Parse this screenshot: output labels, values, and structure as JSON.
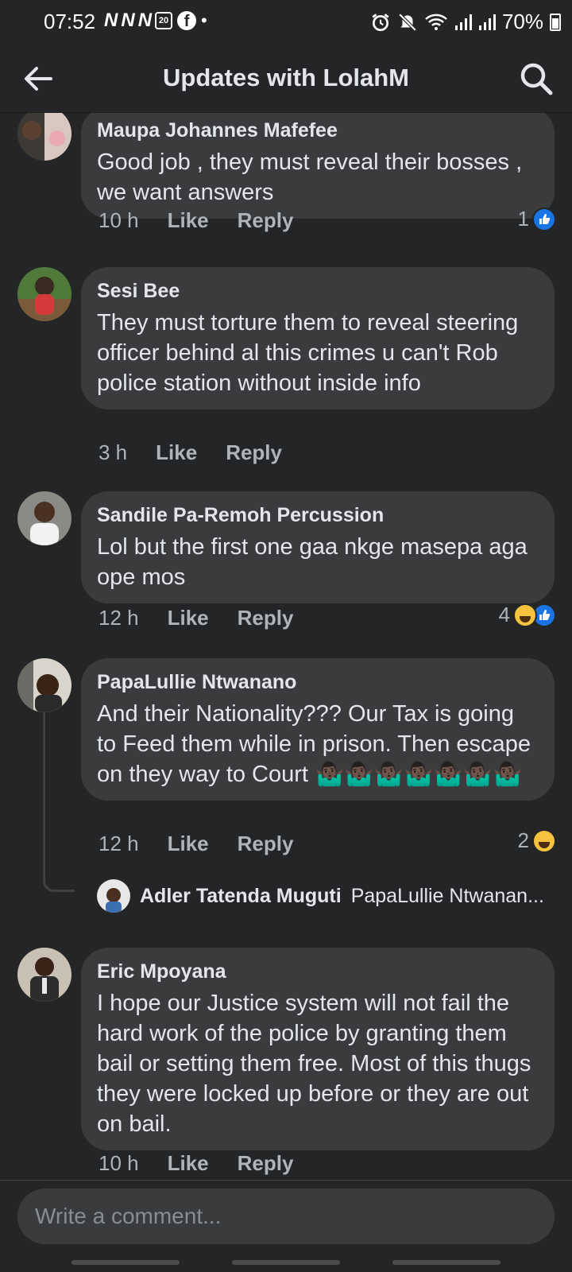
{
  "status_bar": {
    "time": "07:52",
    "notif_icons": [
      "N",
      "N",
      "N"
    ],
    "calendar_day": "20",
    "battery": "70%",
    "icons": [
      "alarm-icon",
      "mute-icon",
      "wifi-icon",
      "signal-icon",
      "signal-icon",
      "battery-icon"
    ]
  },
  "header": {
    "title": "Updates with LolahM"
  },
  "comments": [
    {
      "author": "Maupa Johannes Mafefee",
      "text": "Good job , they must reveal their bosses , we want answers",
      "ago": "10 h",
      "like_label": "Like",
      "reply_label": "Reply",
      "reaction_count": "1",
      "reactions": [
        "like"
      ]
    },
    {
      "author": "Sesi Bee",
      "text": "They must torture them to reveal steering officer behind al this crimes u can't Rob police station without inside info",
      "ago": "3 h",
      "like_label": "Like",
      "reply_label": "Reply"
    },
    {
      "author": "Sandile Pa-Remoh Percussion",
      "text": "Lol but the first one gaa nkge masepa aga ope mos",
      "ago": "12 h",
      "like_label": "Like",
      "reply_label": "Reply",
      "reaction_count": "4",
      "reactions": [
        "haha",
        "like"
      ]
    },
    {
      "author": "PapaLullie Ntwanano",
      "text": "And their Nationality??? Our Tax is going to Feed them while in prison. Then escape on they way to Court",
      "emojis": "🤷🏿‍♂️🤷🏿‍♂️🤷🏿‍♂️🤷🏿‍♂️🤷🏿‍♂️🤷🏿‍♂️🤷🏿‍♂️",
      "ago": "12 h",
      "like_label": "Like",
      "reply_label": "Reply",
      "reaction_count": "2",
      "reactions": [
        "haha"
      ],
      "reply_preview": {
        "author": "Adler Tatenda Muguti",
        "text": "PapaLullie Ntwanan..."
      }
    },
    {
      "author": "Eric Mpoyana",
      "text": "I hope our Justice system will not fail the hard work of the police by granting them bail or setting them free. Most of this thugs they were locked up before or they are out on bail.",
      "ago": "10 h",
      "like_label": "Like",
      "reply_label": "Reply"
    }
  ],
  "composer": {
    "placeholder": "Write a comment..."
  }
}
